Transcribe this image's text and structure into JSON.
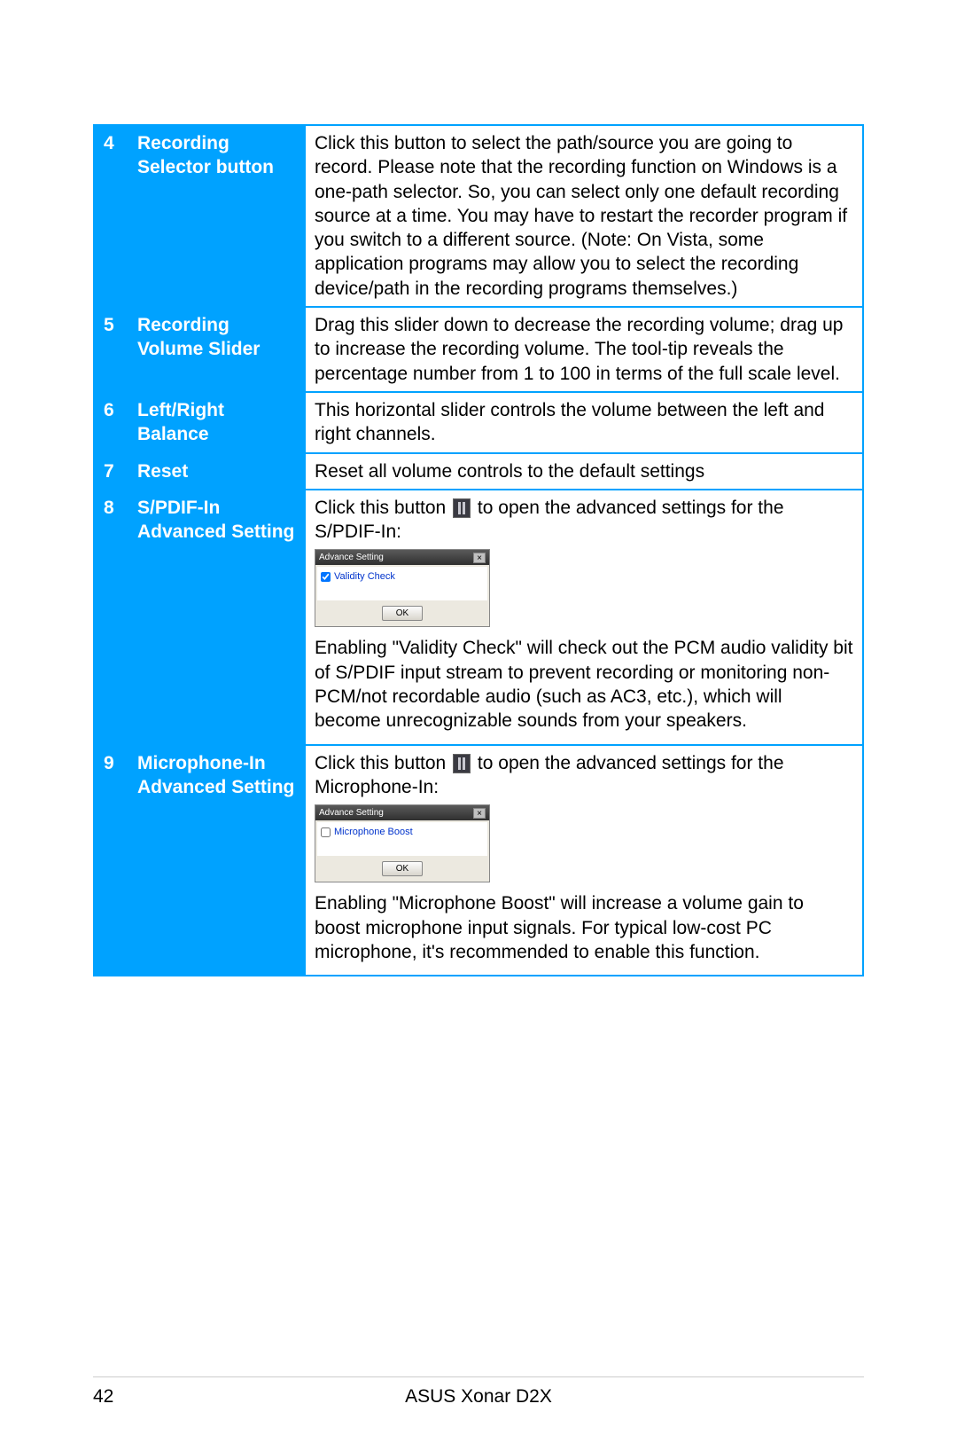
{
  "footer": {
    "page_number": "42",
    "title": "ASUS Xonar D2X"
  },
  "dialog": {
    "title": "Advance Setting",
    "close": "×",
    "ok": "OK",
    "validity_label": "Validity Check",
    "micboost_label": "Microphone Boost"
  },
  "rows": [
    {
      "num": "4",
      "label": "Recording Selector button",
      "desc": "Click this button to select the path/source you are going to record. Please note that the recording function on Windows is a one-path selector. So, you can select only one default recording source at a time. You may have to restart the recorder program if you switch to a different source. (Note: On Vista, some application programs may allow you to select the recording device/path in the recording programs themselves.)"
    },
    {
      "num": "5",
      "label": "Recording Volume Slider",
      "desc": "Drag this slider down to decrease the recording volume; drag up to increase the recording volume. The tool-tip reveals the percentage number from 1 to 100 in terms of the full scale level."
    },
    {
      "num": "6",
      "label": "Left/Right Balance",
      "desc": "This horizontal slider controls the volume between the left and right channels."
    },
    {
      "num": "7",
      "label": "Reset",
      "desc": "Reset all volume controls to the default settings"
    },
    {
      "num": "8",
      "label": "S/PDIF-In Advanced Setting",
      "desc_pre": "Click this button ",
      "desc_post": " to open the advanced settings for the S/PDIF-In:",
      "desc_after": "Enabling \"Validity Check\" will check out the PCM audio validity bit of S/PDIF input stream to prevent recording or monitoring non-PCM/not recordable audio (such as AC3, etc.), which will become unrecognizable sounds from your speakers."
    },
    {
      "num": "9",
      "label": "Microphone-In Advanced Setting",
      "desc_pre": "Click this button ",
      "desc_post": " to open the advanced settings for the Microphone-In:",
      "desc_after": "Enabling \"Microphone Boost\" will increase a volume gain to boost microphone input signals. For typical low-cost PC microphone, it's recommended to enable this function."
    }
  ]
}
